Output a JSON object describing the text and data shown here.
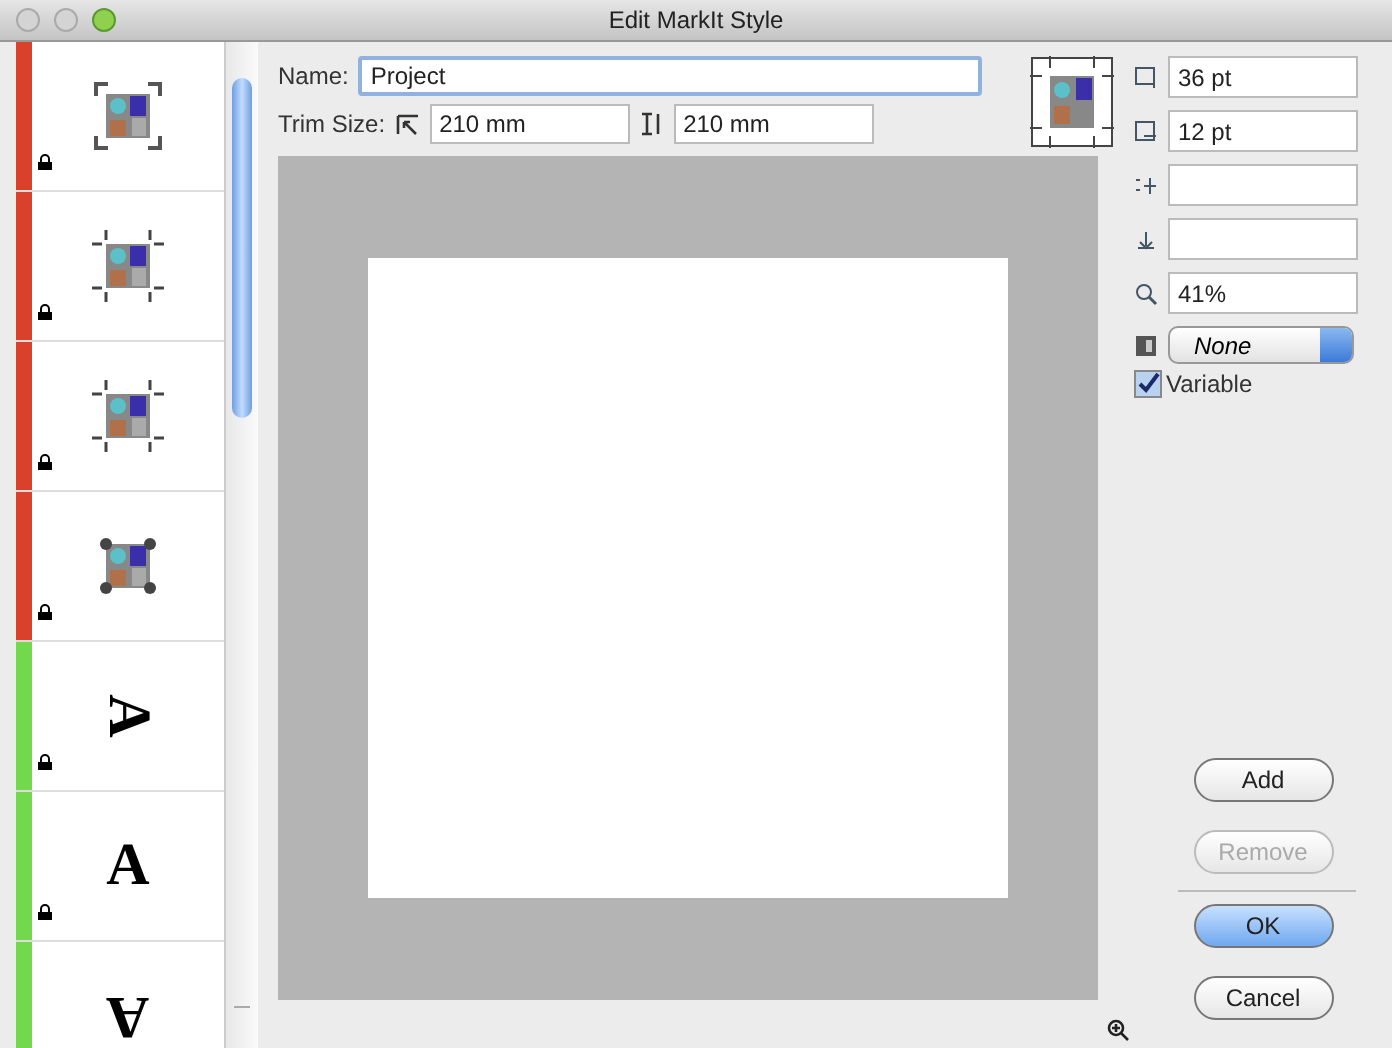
{
  "window": {
    "title": "Edit MarkIt Style"
  },
  "styles": [
    {
      "kind": "corner-marks",
      "color": "#d9412b"
    },
    {
      "kind": "crop-marks",
      "color": "#d9412b"
    },
    {
      "kind": "crop-marks",
      "color": "#d9412b"
    },
    {
      "kind": "dot-marks",
      "color": "#d9412b"
    },
    {
      "kind": "letter-right",
      "glyph": "A",
      "color": "#72d94c"
    },
    {
      "kind": "letter",
      "glyph": "A",
      "color": "#72d94c"
    },
    {
      "kind": "letter-down",
      "glyph": "A",
      "color": "#72d94c"
    }
  ],
  "name": {
    "label": "Name:",
    "value": "Project"
  },
  "trim": {
    "label": "Trim Size:",
    "width": "210 mm",
    "height": "210 mm"
  },
  "fields": [
    {
      "kind": "top",
      "value": "36 pt"
    },
    {
      "kind": "side",
      "value": "12 pt"
    },
    {
      "kind": "hoff"
    },
    {
      "kind": "voff"
    },
    {
      "kind": "zoom",
      "value": "41%"
    }
  ],
  "popup": {
    "value": "None"
  },
  "variable": {
    "label": "Variable",
    "checked": true
  },
  "buttons": [
    {
      "label": "Add",
      "kind": "normal",
      "disabled": false
    },
    {
      "label": "Remove",
      "kind": "normal",
      "disabled": true
    },
    {
      "label": "OK",
      "kind": "default",
      "disabled": false
    },
    {
      "label": "Cancel",
      "kind": "normal",
      "disabled": false
    }
  ]
}
